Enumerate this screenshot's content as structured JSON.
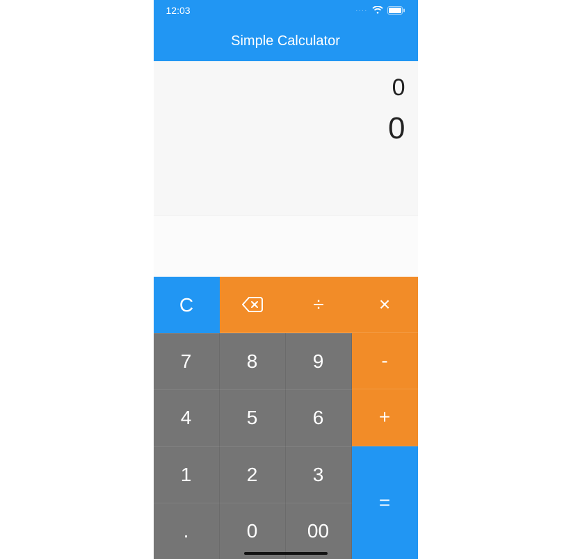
{
  "status": {
    "time": "12:03"
  },
  "header": {
    "title": "Simple Calculator"
  },
  "display": {
    "expression": "0",
    "result": "0"
  },
  "keys": {
    "clear": "C",
    "divide": "÷",
    "multiply": "×",
    "minus": "-",
    "plus": "+",
    "equals": "=",
    "dot": ".",
    "zero": "0",
    "doublezero": "00",
    "n1": "1",
    "n2": "2",
    "n3": "3",
    "n4": "4",
    "n5": "5",
    "n6": "6",
    "n7": "7",
    "n8": "8",
    "n9": "9"
  },
  "colors": {
    "primary": "#2196F3",
    "accent": "#F28C28",
    "numpad": "#757575"
  }
}
